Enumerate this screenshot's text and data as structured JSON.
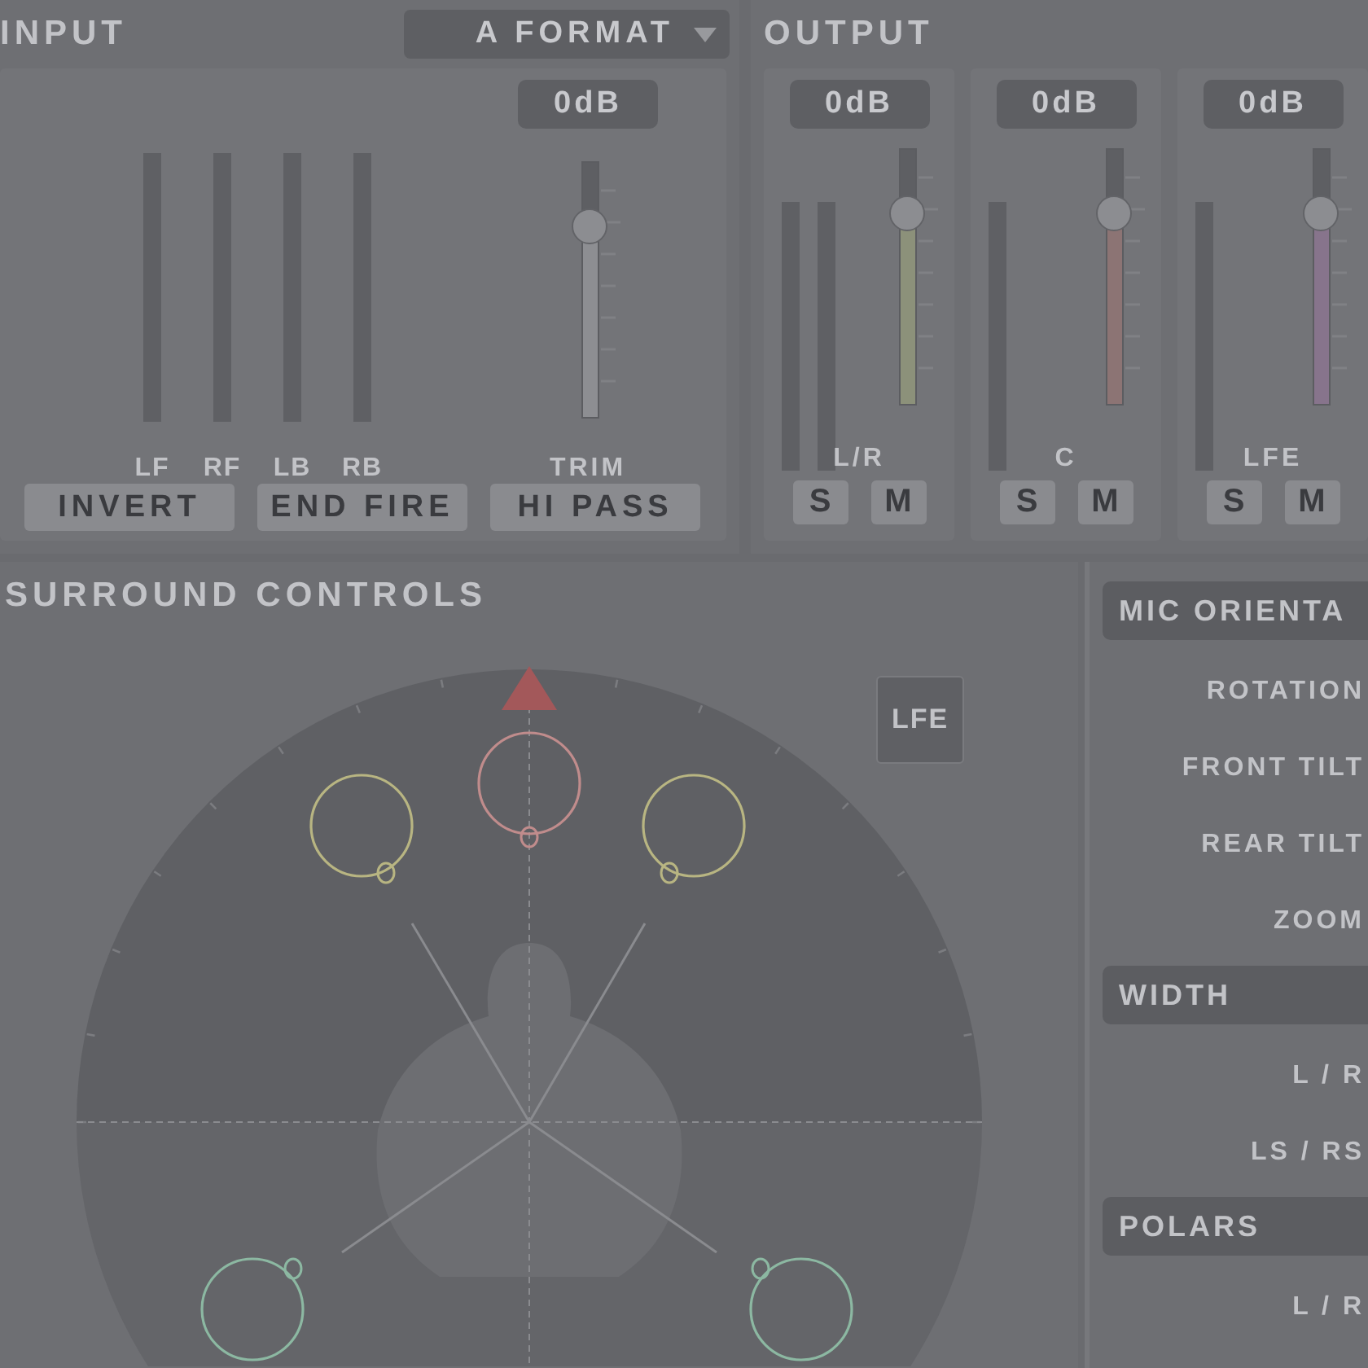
{
  "input": {
    "title": "INPUT",
    "format_dropdown": {
      "value": "A FORMAT"
    },
    "meters": [
      {
        "label": "LF"
      },
      {
        "label": "RF"
      },
      {
        "label": "LB"
      },
      {
        "label": "RB"
      }
    ],
    "trim": {
      "reading": "0dB",
      "level": 0.75,
      "label": "TRIM"
    },
    "buttons": [
      "INVERT",
      "END FIRE",
      "HI PASS"
    ]
  },
  "output": {
    "title": "OUTPUT",
    "channels": [
      {
        "reading": "0dB",
        "kind": "stereo",
        "level": 0.75,
        "color": "#8c917a",
        "label": "L/R",
        "solo": "S",
        "mute": "M"
      },
      {
        "reading": "0dB",
        "kind": "mono",
        "level": 0.75,
        "color": "#8c7474",
        "label": "C",
        "solo": "S",
        "mute": "M"
      },
      {
        "reading": "0dB",
        "kind": "mono",
        "level": 0.75,
        "color": "#87748c",
        "label": "LFE",
        "solo": "S",
        "mute": "M"
      }
    ]
  },
  "surround": {
    "title": "SURROUND CONTROLS",
    "lfe_button": "LFE"
  },
  "side_panel": {
    "sections": [
      {
        "title": "MIC ORIENTA",
        "controls": [
          "ROTATION",
          "FRONT TILT",
          "REAR TILT",
          "ZOOM"
        ]
      },
      {
        "title": "WIDTH",
        "controls": [
          "L / R",
          "LS / RS"
        ]
      },
      {
        "title": "POLARS",
        "controls": [
          "L / R"
        ]
      }
    ]
  }
}
